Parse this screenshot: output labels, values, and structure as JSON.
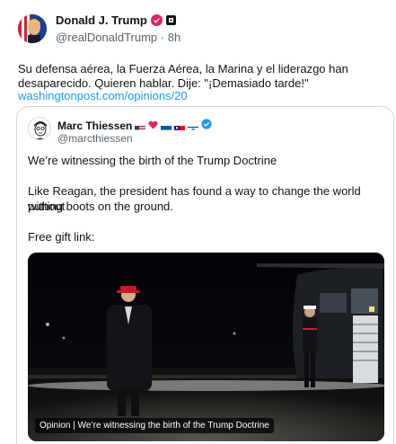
{
  "author": {
    "name": "Donald J. Trump",
    "handle": "@realDonaldTrump",
    "separator": "·",
    "time": "8h"
  },
  "post": {
    "text_line1": "Su defensa aérea, la Fuerza Aérea, la Marina y el liderazgo han",
    "text_line2": "desaparecido. Quieren hablar. Dije: \"¡Demasiado tarde!\"",
    "link": "washingtonpost.com/opinions/20"
  },
  "quoted": {
    "name": "Marc Thiessen",
    "handle": "@marcthiessen",
    "flags": [
      "us-flag-icon",
      "red-heart-icon",
      "ukraine-flag-icon",
      "taiwan-flag-icon",
      "israel-flag-icon"
    ],
    "line1": "We’re witnessing the birth of the Trump Doctrine",
    "line2": "Like Reagan, the president has found a way to change the world without",
    "line3": "putting boots on the ground.",
    "line4": "Free gift link:",
    "media_caption": "Opinion | We’re witnessing the birth of the Trump Doctrine"
  },
  "colors": {
    "link": "#1d9bf0",
    "verified": "#1d9bf0",
    "badge": "#e0245e",
    "muted": "#536471",
    "border": "#cfd9de"
  }
}
